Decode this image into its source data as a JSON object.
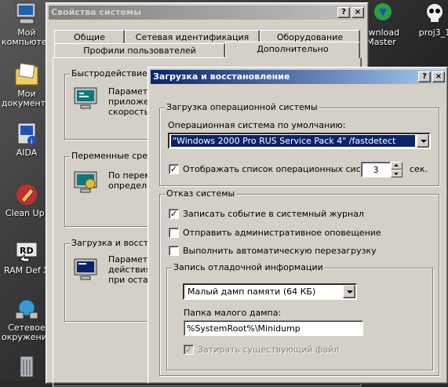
{
  "desktop": {
    "icons": [
      {
        "label": "Мой компьютер"
      },
      {
        "label": "Мои документы"
      },
      {
        "label": "AIDA"
      },
      {
        "label": "Clean Up!"
      },
      {
        "label": "RAM Def X"
      },
      {
        "label": "Сетевое окружение"
      },
      {
        "label": "ownload Master"
      },
      {
        "label": "proj3_1"
      }
    ]
  },
  "sysprops": {
    "title": "Свойства системы",
    "help_btn": "?",
    "close_btn": "×",
    "tabs_row1": [
      "Общие",
      "Сетевая идентификация",
      "Оборудование"
    ],
    "tabs_row2": [
      "Профили пользователей",
      "Дополнительно"
    ],
    "sections": [
      {
        "legend": "Быстродействие",
        "text": [
          "Параметр",
          "приложен",
          "скорость"
        ]
      },
      {
        "legend": "Переменные сред",
        "text": [
          "По перем",
          "определе"
        ]
      },
      {
        "legend": "Загрузка и восстан",
        "text": [
          "Параметр",
          "действия,",
          "при остан"
        ]
      }
    ]
  },
  "boot": {
    "title": "Загрузка и восстановление",
    "help_btn": "?",
    "close_btn": "×",
    "os_group": {
      "legend": "Загрузка операционной системы",
      "default_os_label": "Операционная система по умолчанию:",
      "default_os_value": "\"Windows 2000 Pro RUS Service Pack 4\" /fastdetect",
      "show_list_label": "Отображать список операционных систем",
      "show_list_checked": true,
      "timeout_value": "3",
      "seconds_label": "сек."
    },
    "failure_group": {
      "legend": "Отказ системы",
      "options": [
        {
          "label": "Записать событие в системный журнал",
          "checked": true
        },
        {
          "label": "Отправить административное оповещение",
          "checked": false
        },
        {
          "label": "Выполнить автоматическую перезагрузку",
          "checked": false
        }
      ]
    },
    "debug_group": {
      "legend": "Запись отладочной информации",
      "dump_type": "Малый дамп памяти (64 КБ)",
      "dump_folder_label": "Папка малого дампа:",
      "dump_folder_value": "%SystemRoot%\\Minidump",
      "overwrite_label": "Затирать существующий файл",
      "overwrite_checked": true,
      "overwrite_disabled": true
    }
  }
}
